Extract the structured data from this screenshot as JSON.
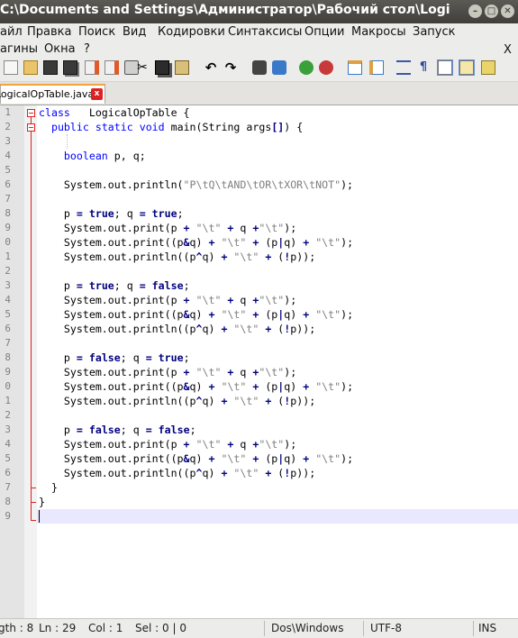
{
  "window": {
    "title": "C:\\Documents and Settings\\Администратор\\Рабочий стол\\Logical...",
    "min": "–",
    "max": "□",
    "close": "✕"
  },
  "menu": [
    "айл",
    "Правка",
    "Поиск",
    "Вид",
    "Кодировки",
    "Синтаксисы",
    "Опции",
    "Макросы",
    "Запуск",
    "агины",
    "Окна",
    "?"
  ],
  "menu_close": "X",
  "toolbar_icons": [
    "new-file-icon",
    "open-file-icon",
    "save-icon",
    "save-all-icon",
    "close-icon",
    "close-all-icon",
    "print-icon",
    "cut-icon",
    "copy-icon",
    "paste-icon",
    "undo-icon",
    "redo-icon",
    "find-icon",
    "replace-icon",
    "zoom-in-icon",
    "zoom-out-icon",
    "sync-v-icon",
    "sync-h-icon",
    "wrap-icon",
    "show-all-chars-icon",
    "indent-guide-icon",
    "doc-map-icon",
    "function-list-icon"
  ],
  "tab": {
    "label": "LogicalOpTable.java",
    "close": "x"
  },
  "line_numbers": [
    "1",
    "2",
    "3",
    "4",
    "5",
    "6",
    "7",
    "8",
    "9",
    "0",
    "1",
    "2",
    "3",
    "4",
    "5",
    "6",
    "7",
    "8",
    "9",
    "0",
    "1",
    "2",
    "3",
    "4",
    "5",
    "6",
    "7",
    "8",
    "9"
  ],
  "code": [
    [
      [
        "kw",
        "class"
      ],
      [
        "",
        "   LogicalOpTable {"
      ]
    ],
    [
      [
        "",
        "  "
      ],
      [
        "kw",
        "public"
      ],
      [
        "",
        " "
      ],
      [
        "kw",
        "static"
      ],
      [
        "",
        " "
      ],
      [
        "kw",
        "void"
      ],
      [
        "",
        " main(String args"
      ],
      [
        "op",
        "[]"
      ],
      [
        "",
        ") {"
      ]
    ],
    [
      [
        "",
        ""
      ]
    ],
    [
      [
        "",
        "    "
      ],
      [
        "kw",
        "boolean"
      ],
      [
        "",
        " p, q;"
      ]
    ],
    [
      [
        "",
        ""
      ]
    ],
    [
      [
        "",
        "    System.out.println("
      ],
      [
        "str",
        "\"P\\tQ\\tAND\\tOR\\tXOR\\tNOT\""
      ],
      [
        "",
        ");"
      ]
    ],
    [
      [
        "",
        ""
      ]
    ],
    [
      [
        "",
        "    p "
      ],
      [
        "op",
        "="
      ],
      [
        "",
        " "
      ],
      [
        "kwb",
        "true"
      ],
      [
        "",
        "; q "
      ],
      [
        "op",
        "="
      ],
      [
        "",
        " "
      ],
      [
        "kwb",
        "true"
      ],
      [
        "",
        ";"
      ]
    ],
    [
      [
        "",
        "    System.out.print(p "
      ],
      [
        "op",
        "+"
      ],
      [
        "",
        " "
      ],
      [
        "str",
        "\"\\t\""
      ],
      [
        "",
        " "
      ],
      [
        "op",
        "+"
      ],
      [
        "",
        " q "
      ],
      [
        "op",
        "+"
      ],
      [
        "str",
        "\"\\t\""
      ],
      [
        "",
        ");"
      ]
    ],
    [
      [
        "",
        "    System.out.print((p"
      ],
      [
        "op",
        "&"
      ],
      [
        "",
        "q) "
      ],
      [
        "op",
        "+"
      ],
      [
        "",
        " "
      ],
      [
        "str",
        "\"\\t\""
      ],
      [
        "",
        " "
      ],
      [
        "op",
        "+"
      ],
      [
        "",
        " (p"
      ],
      [
        "op",
        "|"
      ],
      [
        "",
        "q) "
      ],
      [
        "op",
        "+"
      ],
      [
        "",
        " "
      ],
      [
        "str",
        "\"\\t\""
      ],
      [
        "",
        ");"
      ]
    ],
    [
      [
        "",
        "    System.out.println((p"
      ],
      [
        "op",
        "^"
      ],
      [
        "",
        "q) "
      ],
      [
        "op",
        "+"
      ],
      [
        "",
        " "
      ],
      [
        "str",
        "\"\\t\""
      ],
      [
        "",
        " "
      ],
      [
        "op",
        "+"
      ],
      [
        "",
        " ("
      ],
      [
        "op",
        "!"
      ],
      [
        "",
        "p));"
      ]
    ],
    [
      [
        "",
        ""
      ]
    ],
    [
      [
        "",
        "    p "
      ],
      [
        "op",
        "="
      ],
      [
        "",
        " "
      ],
      [
        "kwb",
        "true"
      ],
      [
        "",
        "; q "
      ],
      [
        "op",
        "="
      ],
      [
        "",
        " "
      ],
      [
        "kwb",
        "false"
      ],
      [
        "",
        ";"
      ]
    ],
    [
      [
        "",
        "    System.out.print(p "
      ],
      [
        "op",
        "+"
      ],
      [
        "",
        " "
      ],
      [
        "str",
        "\"\\t\""
      ],
      [
        "",
        " "
      ],
      [
        "op",
        "+"
      ],
      [
        "",
        " q "
      ],
      [
        "op",
        "+"
      ],
      [
        "str",
        "\"\\t\""
      ],
      [
        "",
        ");"
      ]
    ],
    [
      [
        "",
        "    System.out.print((p"
      ],
      [
        "op",
        "&"
      ],
      [
        "",
        "q) "
      ],
      [
        "op",
        "+"
      ],
      [
        "",
        " "
      ],
      [
        "str",
        "\"\\t\""
      ],
      [
        "",
        " "
      ],
      [
        "op",
        "+"
      ],
      [
        "",
        " (p"
      ],
      [
        "op",
        "|"
      ],
      [
        "",
        "q) "
      ],
      [
        "op",
        "+"
      ],
      [
        "",
        " "
      ],
      [
        "str",
        "\"\\t\""
      ],
      [
        "",
        ");"
      ]
    ],
    [
      [
        "",
        "    System.out.println((p"
      ],
      [
        "op",
        "^"
      ],
      [
        "",
        "q) "
      ],
      [
        "op",
        "+"
      ],
      [
        "",
        " "
      ],
      [
        "str",
        "\"\\t\""
      ],
      [
        "",
        " "
      ],
      [
        "op",
        "+"
      ],
      [
        "",
        " ("
      ],
      [
        "op",
        "!"
      ],
      [
        "",
        "p));"
      ]
    ],
    [
      [
        "",
        ""
      ]
    ],
    [
      [
        "",
        "    p "
      ],
      [
        "op",
        "="
      ],
      [
        "",
        " "
      ],
      [
        "kwb",
        "false"
      ],
      [
        "",
        "; q "
      ],
      [
        "op",
        "="
      ],
      [
        "",
        " "
      ],
      [
        "kwb",
        "true"
      ],
      [
        "",
        ";"
      ]
    ],
    [
      [
        "",
        "    System.out.print(p "
      ],
      [
        "op",
        "+"
      ],
      [
        "",
        " "
      ],
      [
        "str",
        "\"\\t\""
      ],
      [
        "",
        " "
      ],
      [
        "op",
        "+"
      ],
      [
        "",
        " q "
      ],
      [
        "op",
        "+"
      ],
      [
        "str",
        "\"\\t\""
      ],
      [
        "",
        ");"
      ]
    ],
    [
      [
        "",
        "    System.out.print((p"
      ],
      [
        "op",
        "&"
      ],
      [
        "",
        "q) "
      ],
      [
        "op",
        "+"
      ],
      [
        "",
        " "
      ],
      [
        "str",
        "\"\\t\""
      ],
      [
        "",
        " "
      ],
      [
        "op",
        "+"
      ],
      [
        "",
        " (p"
      ],
      [
        "op",
        "|"
      ],
      [
        "",
        "q) "
      ],
      [
        "op",
        "+"
      ],
      [
        "",
        " "
      ],
      [
        "str",
        "\"\\t\""
      ],
      [
        "",
        ");"
      ]
    ],
    [
      [
        "",
        "    System.out.println((p"
      ],
      [
        "op",
        "^"
      ],
      [
        "",
        "q) "
      ],
      [
        "op",
        "+"
      ],
      [
        "",
        " "
      ],
      [
        "str",
        "\"\\t\""
      ],
      [
        "",
        " "
      ],
      [
        "op",
        "+"
      ],
      [
        "",
        " ("
      ],
      [
        "op",
        "!"
      ],
      [
        "",
        "p));"
      ]
    ],
    [
      [
        "",
        ""
      ]
    ],
    [
      [
        "",
        "    p "
      ],
      [
        "op",
        "="
      ],
      [
        "",
        " "
      ],
      [
        "kwb",
        "false"
      ],
      [
        "",
        "; q "
      ],
      [
        "op",
        "="
      ],
      [
        "",
        " "
      ],
      [
        "kwb",
        "false"
      ],
      [
        "",
        ";"
      ]
    ],
    [
      [
        "",
        "    System.out.print(p "
      ],
      [
        "op",
        "+"
      ],
      [
        "",
        " "
      ],
      [
        "str",
        "\"\\t\""
      ],
      [
        "",
        " "
      ],
      [
        "op",
        "+"
      ],
      [
        "",
        " q "
      ],
      [
        "op",
        "+"
      ],
      [
        "str",
        "\"\\t\""
      ],
      [
        "",
        ");"
      ]
    ],
    [
      [
        "",
        "    System.out.print((p"
      ],
      [
        "op",
        "&"
      ],
      [
        "",
        "q) "
      ],
      [
        "op",
        "+"
      ],
      [
        "",
        " "
      ],
      [
        "str",
        "\"\\t\""
      ],
      [
        "",
        " "
      ],
      [
        "op",
        "+"
      ],
      [
        "",
        " (p"
      ],
      [
        "op",
        "|"
      ],
      [
        "",
        "q) "
      ],
      [
        "op",
        "+"
      ],
      [
        "",
        " "
      ],
      [
        "str",
        "\"\\t\""
      ],
      [
        "",
        ");"
      ]
    ],
    [
      [
        "",
        "    System.out.println((p"
      ],
      [
        "op",
        "^"
      ],
      [
        "",
        "q) "
      ],
      [
        "op",
        "+"
      ],
      [
        "",
        " "
      ],
      [
        "str",
        "\"\\t\""
      ],
      [
        "",
        " "
      ],
      [
        "op",
        "+"
      ],
      [
        "",
        " ("
      ],
      [
        "op",
        "!"
      ],
      [
        "",
        "p));"
      ]
    ],
    [
      [
        "",
        "  }"
      ]
    ],
    [
      [
        "",
        "}"
      ]
    ],
    [
      [
        "",
        ""
      ]
    ]
  ],
  "status": {
    "length": "gth : 8",
    "ln": "Ln : 29",
    "col": "Col : 1",
    "sel": "Sel : 0 | 0",
    "eol": "Dos\\Windows",
    "enc": "UTF-8",
    "mode": "INS"
  },
  "colors": {
    "keyword": "#0000ff",
    "operator": "#000080",
    "string": "#808080",
    "fold": "#e02020",
    "tab_accent": "#f2a33a"
  }
}
